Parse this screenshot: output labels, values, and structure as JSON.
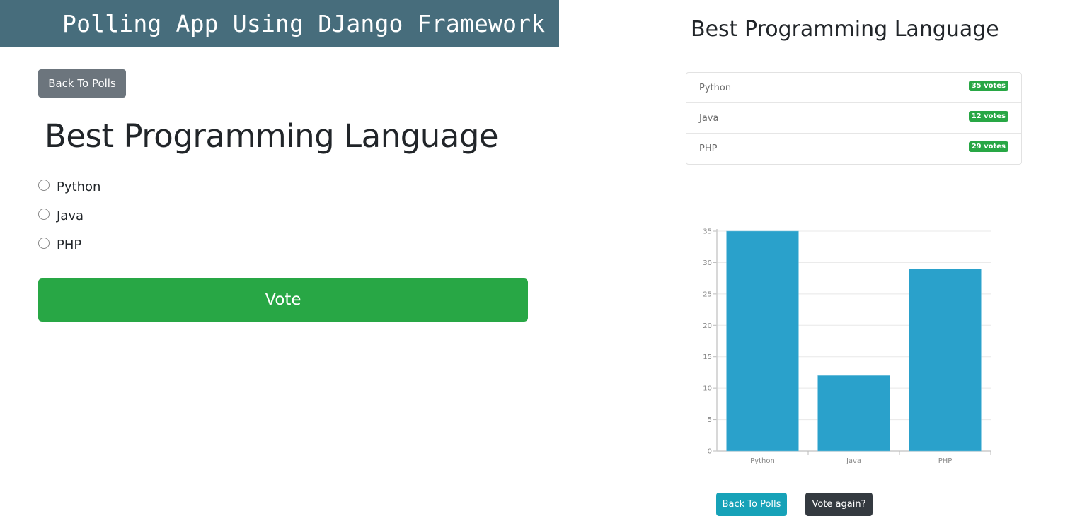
{
  "header": {
    "title": "Polling App Using DJango Framework"
  },
  "vote_panel": {
    "back_label": "Back To Polls",
    "question": "Best Programming Language",
    "choices": [
      {
        "label": "Python",
        "selected": false
      },
      {
        "label": "Java",
        "selected": false
      },
      {
        "label": "PHP",
        "selected": false
      }
    ],
    "vote_label": "Vote"
  },
  "results_panel": {
    "question": "Best Programming Language",
    "results": [
      {
        "name": "Python",
        "votes": "35 votes"
      },
      {
        "name": "Java",
        "votes": "12 votes"
      },
      {
        "name": "PHP",
        "votes": "29 votes"
      }
    ],
    "back_label": "Back To Polls",
    "vote_again_label": "Vote again?"
  },
  "colors": {
    "banner": "#476d7c",
    "vote_green": "#28a745",
    "bar_blue": "#2aa1cb",
    "back_gray": "#6c757d",
    "back_teal": "#17a2b8",
    "dark": "#343a40"
  },
  "chart_data": {
    "type": "bar",
    "title": "",
    "xlabel": "",
    "ylabel": "",
    "categories": [
      "Python",
      "Java",
      "PHP"
    ],
    "values": [
      35,
      12,
      29
    ],
    "ylim": [
      0,
      35
    ],
    "yticks": [
      0,
      5,
      10,
      15,
      20,
      25,
      30,
      35
    ],
    "grid": true,
    "legend": "none"
  }
}
